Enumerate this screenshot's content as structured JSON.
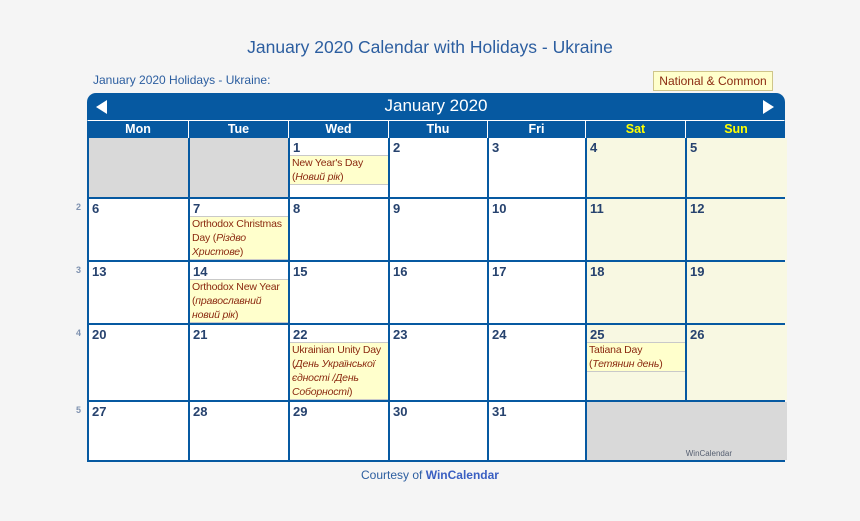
{
  "page": {
    "title": "January 2020 Calendar with Holidays - Ukraine",
    "subtitle": "January 2020 Holidays - Ukraine:",
    "legend": "National & Common"
  },
  "calendar": {
    "month_title": "January 2020",
    "prev_icon": "triangle-left-icon",
    "next_icon": "triangle-right-icon",
    "days_of_week": [
      "Mon",
      "Tue",
      "Wed",
      "Thu",
      "Fri",
      "Sat",
      "Sun"
    ],
    "weekend_color": "#ffff00",
    "header_color": "#0659a1",
    "week_numbers": [
      "2",
      "3",
      "4",
      "5"
    ],
    "watermark": "WinCalendar",
    "weeks": [
      [
        {
          "day": "",
          "empty": true
        },
        {
          "day": "",
          "empty": true
        },
        {
          "day": "1",
          "event": {
            "name": "New Year's Day (",
            "local": "Новий рік",
            "close": ")"
          }
        },
        {
          "day": "2"
        },
        {
          "day": "3"
        },
        {
          "day": "4",
          "weekend": true
        },
        {
          "day": "5",
          "weekend": true
        }
      ],
      [
        {
          "day": "6"
        },
        {
          "day": "7",
          "event": {
            "name": "Orthodox Christmas Day (",
            "local": "Різдво Христове",
            "close": ")"
          }
        },
        {
          "day": "8"
        },
        {
          "day": "9"
        },
        {
          "day": "10"
        },
        {
          "day": "11",
          "weekend": true
        },
        {
          "day": "12",
          "weekend": true
        }
      ],
      [
        {
          "day": "13"
        },
        {
          "day": "14",
          "event": {
            "name": "Orthodox New Year (",
            "local": "православний новий рік",
            "close": ")"
          }
        },
        {
          "day": "15"
        },
        {
          "day": "16"
        },
        {
          "day": "17"
        },
        {
          "day": "18",
          "weekend": true
        },
        {
          "day": "19",
          "weekend": true
        }
      ],
      [
        {
          "day": "20"
        },
        {
          "day": "21"
        },
        {
          "day": "22",
          "event": {
            "name": "Ukrainian Unity Day (",
            "local": "День Української єдності /День Соборності",
            "close": ")"
          }
        },
        {
          "day": "23"
        },
        {
          "day": "24"
        },
        {
          "day": "25",
          "weekend": true,
          "event": {
            "name": "Tatiana Day (",
            "local": "Тетянин день",
            "close": ")"
          }
        },
        {
          "day": "26",
          "weekend": true
        }
      ],
      [
        {
          "day": "27"
        },
        {
          "day": "28"
        },
        {
          "day": "29"
        },
        {
          "day": "30"
        },
        {
          "day": "31"
        }
      ]
    ]
  },
  "footer": {
    "prefix": "Courtesy of ",
    "link": "WinCalendar"
  }
}
